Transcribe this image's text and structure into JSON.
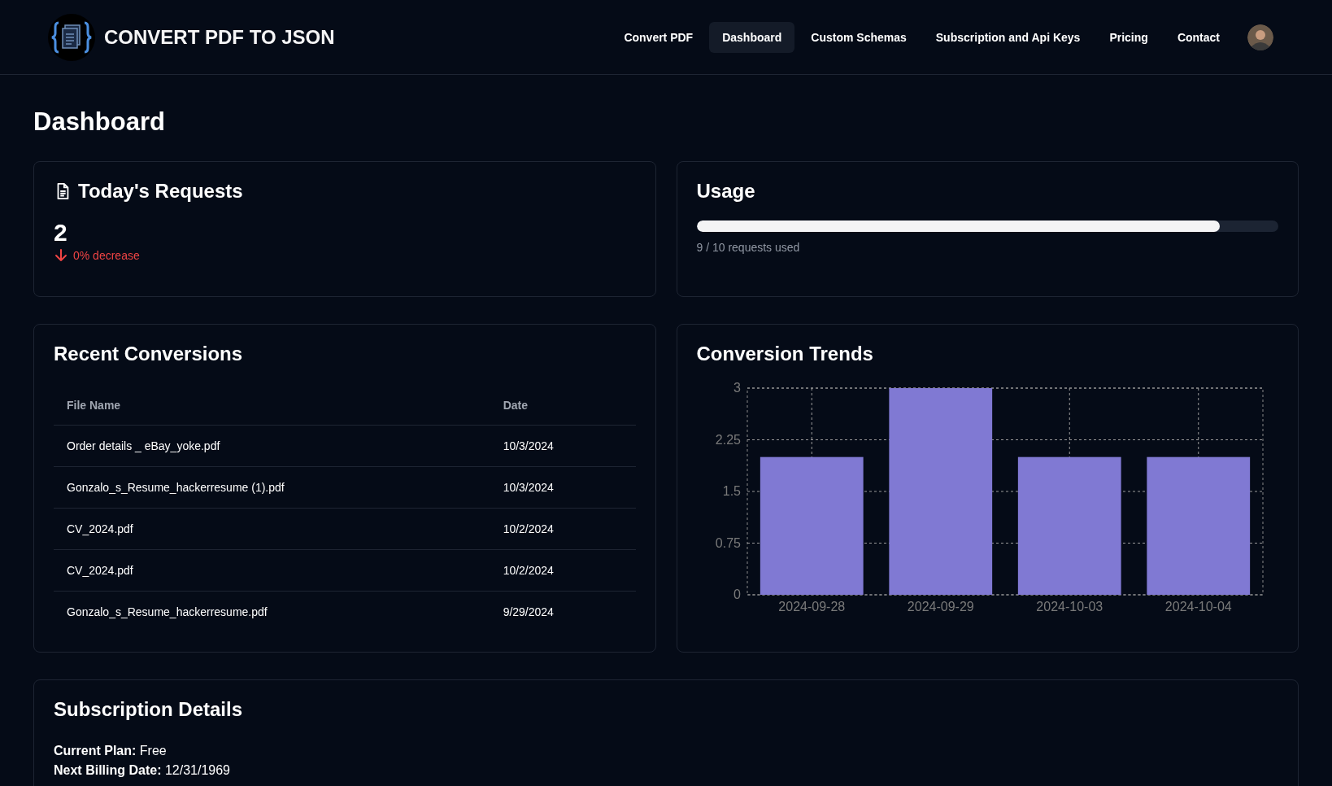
{
  "header": {
    "brand": "CONVERT PDF TO JSON",
    "nav": [
      {
        "label": "Convert PDF",
        "selected": false
      },
      {
        "label": "Dashboard",
        "selected": true
      },
      {
        "label": "Custom Schemas",
        "selected": false
      },
      {
        "label": "Subscription and Api Keys",
        "selected": false
      },
      {
        "label": "Pricing",
        "selected": false
      },
      {
        "label": "Contact",
        "selected": false
      }
    ]
  },
  "page_title": "Dashboard",
  "todays_requests": {
    "title": "Today's Requests",
    "count": "2",
    "change": "0% decrease",
    "kind": "decrease"
  },
  "usage": {
    "title": "Usage",
    "level": 0.9,
    "caption": "9 / 10 requests used"
  },
  "recent_conversions": {
    "title": "Recent Conversions",
    "columns": [
      "File Name",
      "Date"
    ],
    "rows": [
      [
        "Order details _ eBay_yoke.pdf",
        "10/3/2024"
      ],
      [
        "Gonzalo_s_Resume_hackerresume (1).pdf",
        "10/3/2024"
      ],
      [
        "CV_2024.pdf",
        "10/2/2024"
      ],
      [
        "CV_2024.pdf",
        "10/2/2024"
      ],
      [
        "Gonzalo_s_Resume_hackerresume.pdf",
        "9/29/2024"
      ]
    ]
  },
  "conversion_trends": {
    "title": "Conversion Trends",
    "chart_data": {
      "type": "bar",
      "categories": [
        "2024-09-28",
        "2024-09-29",
        "2024-10-03",
        "2024-10-04"
      ],
      "series": [
        {
          "color": "#8079d3",
          "values": [
            2,
            3,
            2,
            2
          ]
        }
      ],
      "grid": true,
      "ylim": [
        0,
        3
      ],
      "yticks": [
        0,
        {
          "value": 0.75,
          "label": "0.75"
        },
        {
          "value": 1.5,
          "label": "1.5"
        },
        {
          "value": 2.25,
          "label": "2.25"
        },
        3
      ]
    }
  },
  "subscription": {
    "title": "Subscription Details",
    "lines": [
      "**Current Plan:** Free",
      "**Next Billing Date:** 12/31/1969"
    ]
  }
}
